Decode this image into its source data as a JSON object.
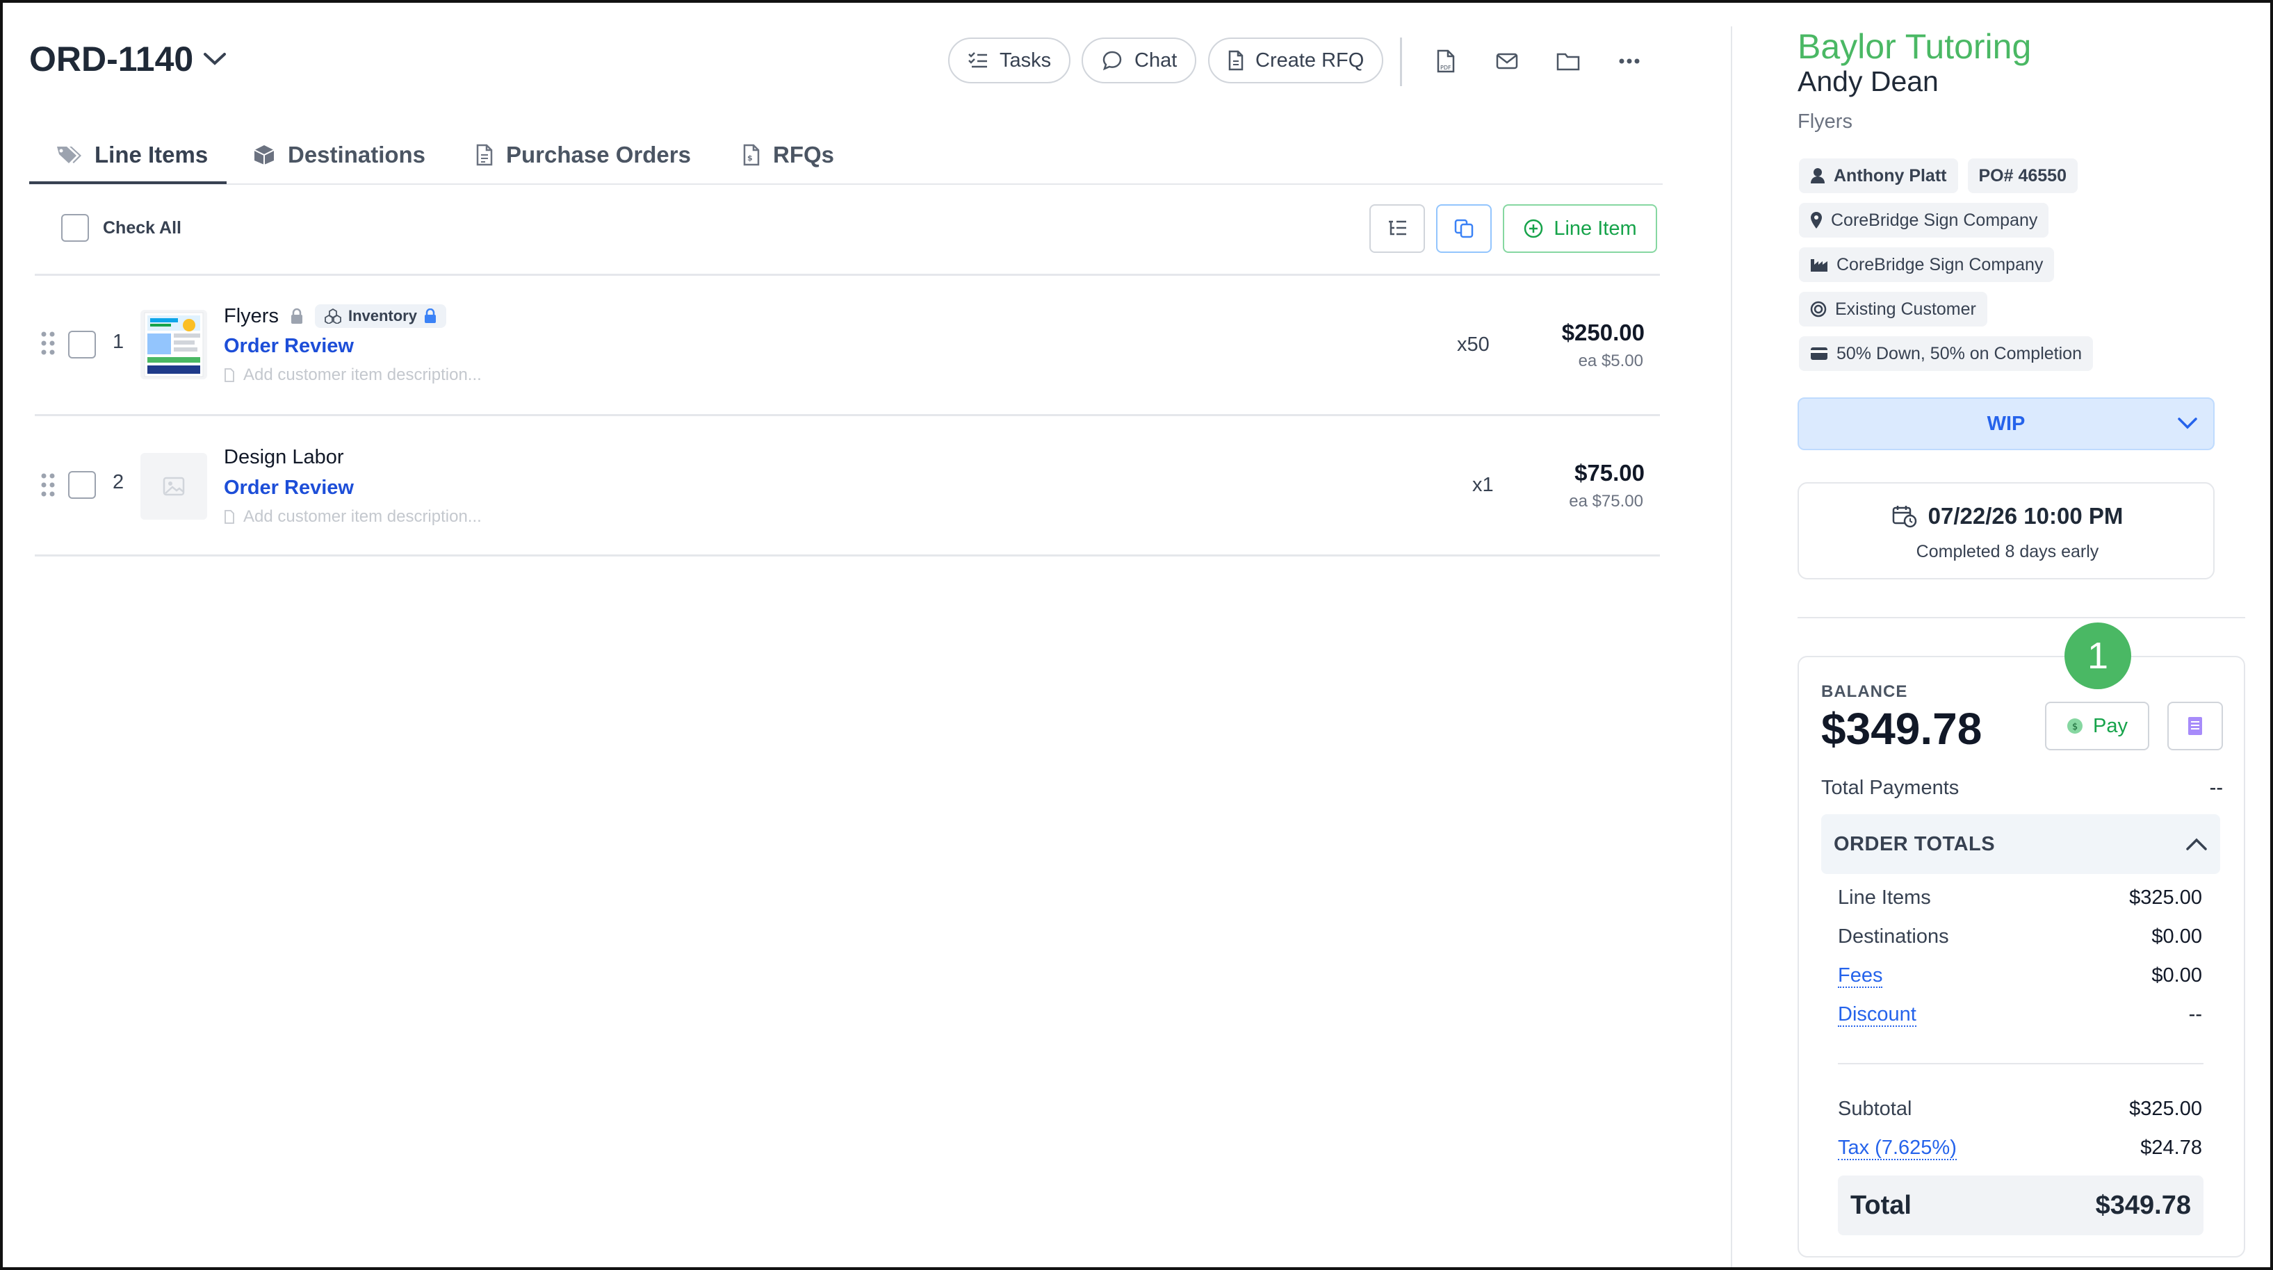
{
  "order": {
    "id": "ORD-1140"
  },
  "toolbar": {
    "tasks_label": "Tasks",
    "chat_label": "Chat",
    "create_rfq_label": "Create RFQ",
    "icons": [
      "pdf-icon",
      "mail-icon",
      "folder-icon",
      "more-icon"
    ]
  },
  "tabs": [
    {
      "label": "Line Items",
      "icon": "tags-icon",
      "active": true
    },
    {
      "label": "Destinations",
      "icon": "box-icon"
    },
    {
      "label": "Purchase Orders",
      "icon": "document-icon"
    },
    {
      "label": "RFQs",
      "icon": "rfq-document-icon"
    }
  ],
  "line_items_toolbar": {
    "check_all_label": "Check All",
    "add_line_item_label": "Line Item"
  },
  "line_items": [
    {
      "number": "1",
      "title": "Flyers",
      "badge": "Inventory",
      "status": "Order Review",
      "description_placeholder": "Add customer item description...",
      "qty": "x50",
      "price": "$250.00",
      "each": "ea $5.00"
    },
    {
      "number": "2",
      "title": "Design Labor",
      "status": "Order Review",
      "description_placeholder": "Add customer item description...",
      "qty": "x1",
      "price": "$75.00",
      "each": "ea $75.00"
    }
  ],
  "sidebar": {
    "company": "Baylor Tutoring",
    "contact": "Andy Dean",
    "product": "Flyers",
    "employee": "Anthony Platt",
    "po": "PO# 46550",
    "location": "CoreBridge Sign Company",
    "division": "CoreBridge Sign Company",
    "customer_type": "Existing Customer",
    "payment_terms": "50% Down, 50% on Completion",
    "status": "WIP",
    "due_date": "07/22/26 10:00 PM",
    "due_note": "Completed 8 days early",
    "marker": "1"
  },
  "balance": {
    "label": "BALANCE",
    "amount": "$349.78",
    "pay_label": "Pay",
    "total_payments_label": "Total Payments",
    "total_payments_value": "--"
  },
  "order_totals": {
    "header": "ORDER TOTALS",
    "line_items_label": "Line Items",
    "line_items_value": "$325.00",
    "destinations_label": "Destinations",
    "destinations_value": "$0.00",
    "fees_label": "Fees",
    "fees_value": "$0.00",
    "discount_label": "Discount",
    "discount_value": "--",
    "subtotal_label": "Subtotal",
    "subtotal_value": "$325.00",
    "tax_label": "Tax (7.625%)",
    "tax_value": "$24.78",
    "total_label": "Total",
    "total_value": "$349.78"
  },
  "colors": {
    "brand_green": "#4ab864",
    "link_blue": "#1d4ed8",
    "wip_bg": "#dbeafe"
  }
}
